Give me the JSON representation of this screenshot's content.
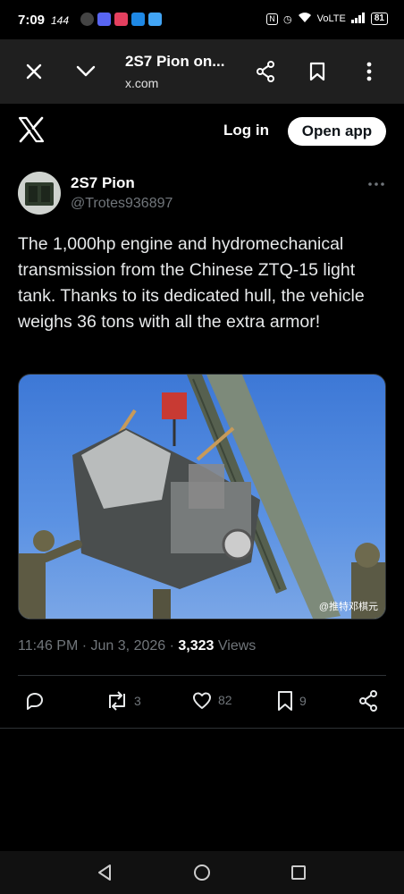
{
  "status_bar": {
    "time": "7:09",
    "rate": "144",
    "network": "VoLTE",
    "battery": "81"
  },
  "browser": {
    "title": "2S7 Pion on...",
    "url": "x.com",
    "close_icon": "close-icon",
    "chevron_icon": "chevron-down-icon",
    "share_icon": "share-icon",
    "bookmark_icon": "bookmark-icon",
    "more_icon": "more-vertical-icon"
  },
  "x_header": {
    "login_label": "Log in",
    "open_app_label": "Open app"
  },
  "tweet": {
    "author": "2S7 Pion",
    "handle": "@Trotes936897",
    "text": "The 1,000hp engine and hydromechanical transmission from the Chinese ZTQ-15 light tank. Thanks to its dedicated hull, the vehicle weighs 36 tons with all the extra armor!",
    "image_watermark": "@推特邓棋元",
    "time": "11:46 PM",
    "date": "Jun 3, 2026",
    "views_count": "3,323",
    "views_label": "Views",
    "reposts": "3",
    "likes": "82",
    "bookmarks": "9"
  },
  "colors": {
    "background": "#000000",
    "text": "#e7e9ea",
    "muted": "#71767b",
    "toolbar": "#1f1f1f"
  }
}
